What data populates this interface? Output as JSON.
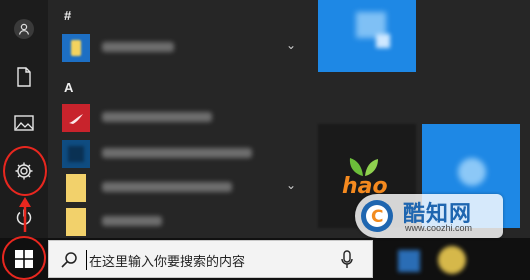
{
  "start_menu": {
    "section_letters": [
      "#",
      "A"
    ],
    "apps": [
      {
        "icon": "app-icon-blue",
        "has_submenu": true
      },
      {
        "icon": "app-icon-red",
        "has_submenu": false
      },
      {
        "icon": "app-icon-darkblue",
        "has_submenu": false
      },
      {
        "icon": "folder-icon",
        "has_submenu": true
      },
      {
        "icon": "folder-icon",
        "has_submenu": true
      },
      {
        "icon": "folder-icon",
        "has_submenu": false
      }
    ],
    "chevron": "⌄"
  },
  "rail": {
    "items": [
      "user-avatar-icon",
      "documents-icon",
      "pictures-icon",
      "settings-icon",
      "power-icon"
    ]
  },
  "tiles": {
    "hao_tile_text": "hao"
  },
  "taskbar": {
    "search_placeholder": "在这里输入你要搜索的内容"
  },
  "watermark": {
    "title": "酷知网",
    "url": "www.coozhi.com"
  },
  "colors": {
    "accent_blue": "#1e88e5",
    "annotation_red": "#e8271f",
    "menu_bg": "#262626"
  }
}
